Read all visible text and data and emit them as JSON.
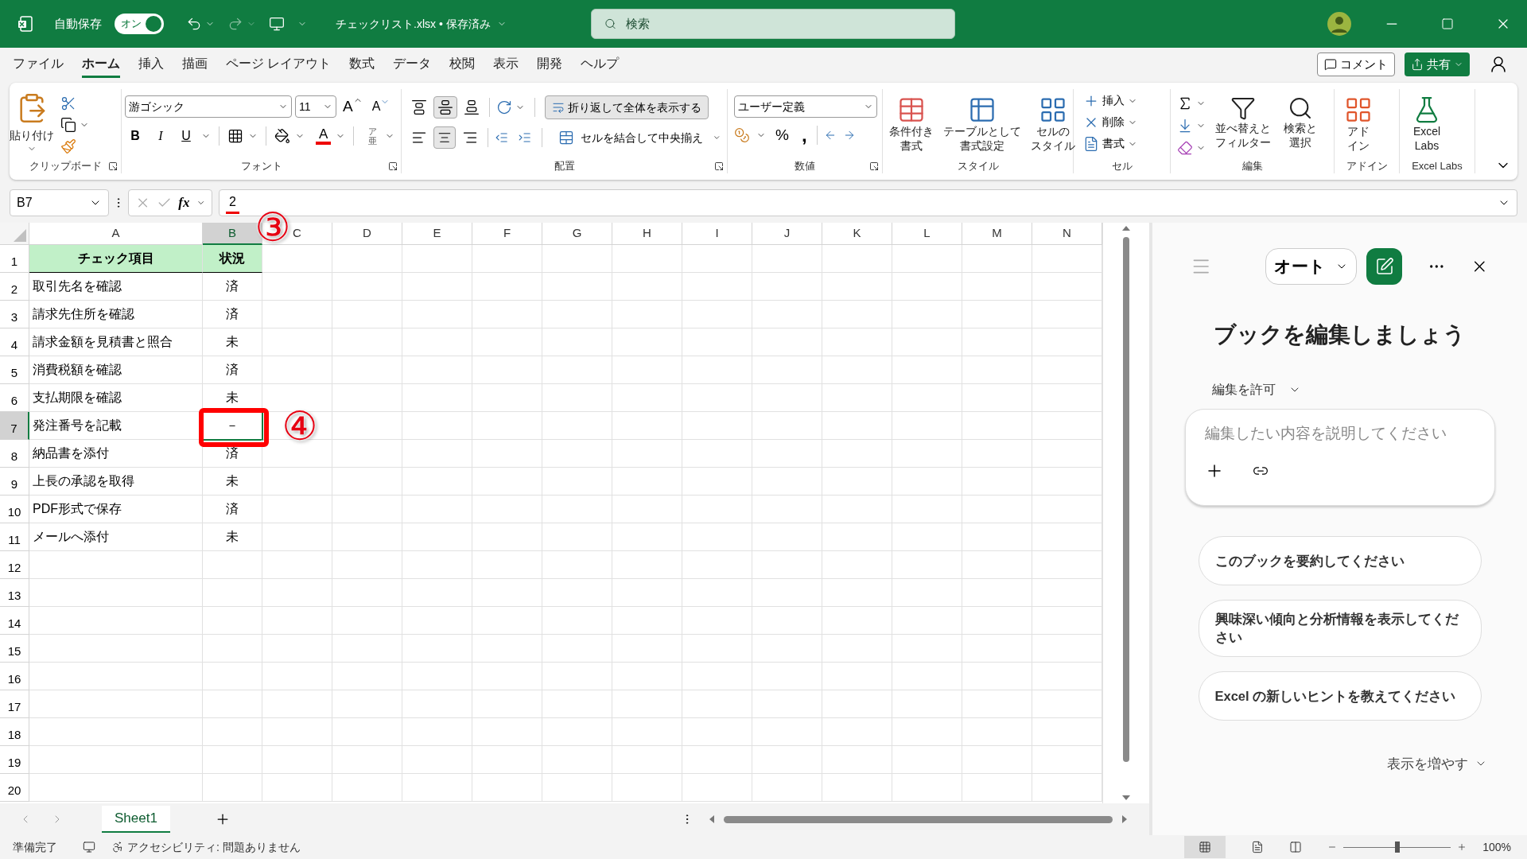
{
  "title_bar": {
    "autosave_label": "自動保存",
    "autosave": {
      "on": true,
      "label": "オン"
    },
    "file_title": "チェックリスト.xlsx • 保存済み",
    "search_placeholder": "検索"
  },
  "menu_tabs": [
    {
      "label": "ファイル",
      "selected": false
    },
    {
      "label": "ホーム",
      "selected": true
    },
    {
      "label": "挿入",
      "selected": false
    },
    {
      "label": "描画",
      "selected": false
    },
    {
      "label": "ページ レイアウト",
      "selected": false
    },
    {
      "label": "数式",
      "selected": false
    },
    {
      "label": "データ",
      "selected": false
    },
    {
      "label": "校閲",
      "selected": false
    },
    {
      "label": "表示",
      "selected": false
    },
    {
      "label": "開発",
      "selected": false
    },
    {
      "label": "ヘルプ",
      "selected": false
    }
  ],
  "header_buttons": {
    "comment": "コメント",
    "share": "共有"
  },
  "ribbon": {
    "groups": [
      {
        "kind": "clipboard",
        "label": "クリップボード",
        "launcher": true,
        "paste": "貼り付け"
      },
      {
        "kind": "font",
        "label": "フォント",
        "launcher": true,
        "font_name": "游ゴシック",
        "font_size": "11",
        "grow": "A",
        "shrink": "A",
        "styles": [
          "B",
          "I",
          "U"
        ],
        "font_color": "A",
        "phonetic": [
          "ア",
          "亜"
        ]
      },
      {
        "kind": "alignment",
        "label": "配置",
        "launcher": true,
        "vertical": [
          {
            "selected": false
          },
          {
            "selected": true
          },
          {
            "selected": false
          }
        ],
        "horizontal": [
          {
            "selected": false
          },
          {
            "selected": true
          },
          {
            "selected": false
          }
        ],
        "wrap": {
          "label": "折り返して全体を表示する",
          "selected": true
        },
        "merge": "セルを結合して中央揃え"
      },
      {
        "kind": "number",
        "label": "数値",
        "launcher": true,
        "format": "ユーザー定義",
        "percent": "%",
        "comma": ","
      },
      {
        "kind": "styles",
        "label": "スタイル",
        "buttons": [
          {
            "lines": [
              "条件付き",
              "書式"
            ]
          },
          {
            "lines": [
              "テーブルとして",
              "書式設定"
            ]
          },
          {
            "lines": [
              "セルの",
              "スタイル"
            ]
          }
        ]
      },
      {
        "kind": "cells",
        "label": "セル",
        "buttons": [
          "挿入",
          "削除",
          "書式"
        ]
      },
      {
        "kind": "editing",
        "label": "編集",
        "buttons": [
          {
            "lines": [
              "並べ替えと",
              "フィルター"
            ]
          },
          {
            "lines": [
              "検索と",
              "選択"
            ]
          }
        ]
      },
      {
        "kind": "addins",
        "label": "アドイン",
        "button": {
          "lines": [
            "アド",
            "イン"
          ]
        }
      },
      {
        "kind": "labs",
        "label": "Excel Labs",
        "button": {
          "lines": [
            "Excel",
            "Labs"
          ]
        }
      }
    ]
  },
  "formula_bar": {
    "name_box": "B7",
    "function_label": "fx",
    "formula": "2",
    "underlined": true
  },
  "sheet": {
    "columns": [
      {
        "label": "A",
        "selected": false
      },
      {
        "label": "B",
        "selected": true
      },
      {
        "label": "C",
        "selected": false
      },
      {
        "label": "D",
        "selected": false
      },
      {
        "label": "E",
        "selected": false
      },
      {
        "label": "F",
        "selected": false
      },
      {
        "label": "G",
        "selected": false
      },
      {
        "label": "H",
        "selected": false
      },
      {
        "label": "I",
        "selected": false
      },
      {
        "label": "J",
        "selected": false
      },
      {
        "label": "K",
        "selected": false
      },
      {
        "label": "L",
        "selected": false
      },
      {
        "label": "M",
        "selected": false
      },
      {
        "label": "N",
        "selected": false
      }
    ],
    "rows": [
      {
        "number": "1",
        "selected": false,
        "kind": "header",
        "cells": [
          "チェック項目",
          "状況"
        ]
      },
      {
        "number": "2",
        "selected": false,
        "kind": "data",
        "cells": [
          "取引先名を確認",
          "済"
        ]
      },
      {
        "number": "3",
        "selected": false,
        "kind": "data",
        "cells": [
          "請求先住所を確認",
          "済"
        ]
      },
      {
        "number": "4",
        "selected": false,
        "kind": "data",
        "cells": [
          "請求金額を見積書と照合",
          "未"
        ]
      },
      {
        "number": "5",
        "selected": false,
        "kind": "data",
        "cells": [
          "消費税額を確認",
          "済"
        ]
      },
      {
        "number": "6",
        "selected": false,
        "kind": "data",
        "cells": [
          "支払期限を確認",
          "未"
        ]
      },
      {
        "number": "7",
        "selected": true,
        "kind": "data",
        "cells": [
          "発注番号を記載",
          "－"
        ]
      },
      {
        "number": "8",
        "selected": false,
        "kind": "data",
        "cells": [
          "納品書を添付",
          "済"
        ]
      },
      {
        "number": "9",
        "selected": false,
        "kind": "data",
        "cells": [
          "上長の承認を取得",
          "未"
        ]
      },
      {
        "number": "10",
        "selected": false,
        "kind": "data",
        "cells": [
          "PDF形式で保存",
          "済"
        ]
      },
      {
        "number": "11",
        "selected": false,
        "kind": "data",
        "cells": [
          "メールへ添付",
          "未"
        ]
      },
      {
        "number": "12",
        "selected": false,
        "kind": "empty"
      },
      {
        "number": "13",
        "selected": false,
        "kind": "empty"
      },
      {
        "number": "14",
        "selected": false,
        "kind": "empty"
      },
      {
        "number": "15",
        "selected": false,
        "kind": "empty"
      },
      {
        "number": "16",
        "selected": false,
        "kind": "empty"
      },
      {
        "number": "17",
        "selected": false,
        "kind": "empty"
      },
      {
        "number": "18",
        "selected": false,
        "kind": "empty"
      },
      {
        "number": "19",
        "selected": false,
        "kind": "empty"
      },
      {
        "number": "20",
        "selected": false,
        "kind": "empty"
      }
    ]
  },
  "annotations": [
    {
      "kind": "circled_number",
      "text": "③"
    },
    {
      "kind": "highlight_box"
    },
    {
      "kind": "circled_number",
      "text": "④"
    }
  ],
  "sheet_tabs": [
    {
      "label": "Sheet1",
      "selected": true
    }
  ],
  "copilot": {
    "mode": "オート",
    "title": "ブックを編集しましょう",
    "permission": "編集を許可",
    "placeholder": "編集したい内容を説明してください",
    "suggestions": [
      "このブックを要約してください",
      "興味深い傾向と分析情報を表示してください",
      "Excel の新しいヒントを教えてください"
    ],
    "more": "表示を増やす"
  },
  "status_bar": {
    "status": "準備完了",
    "accessibility": "アクセシビリティ: 問題ありません",
    "zoom": "100%",
    "zoom_slider": {
      "level": 0.5
    }
  }
}
